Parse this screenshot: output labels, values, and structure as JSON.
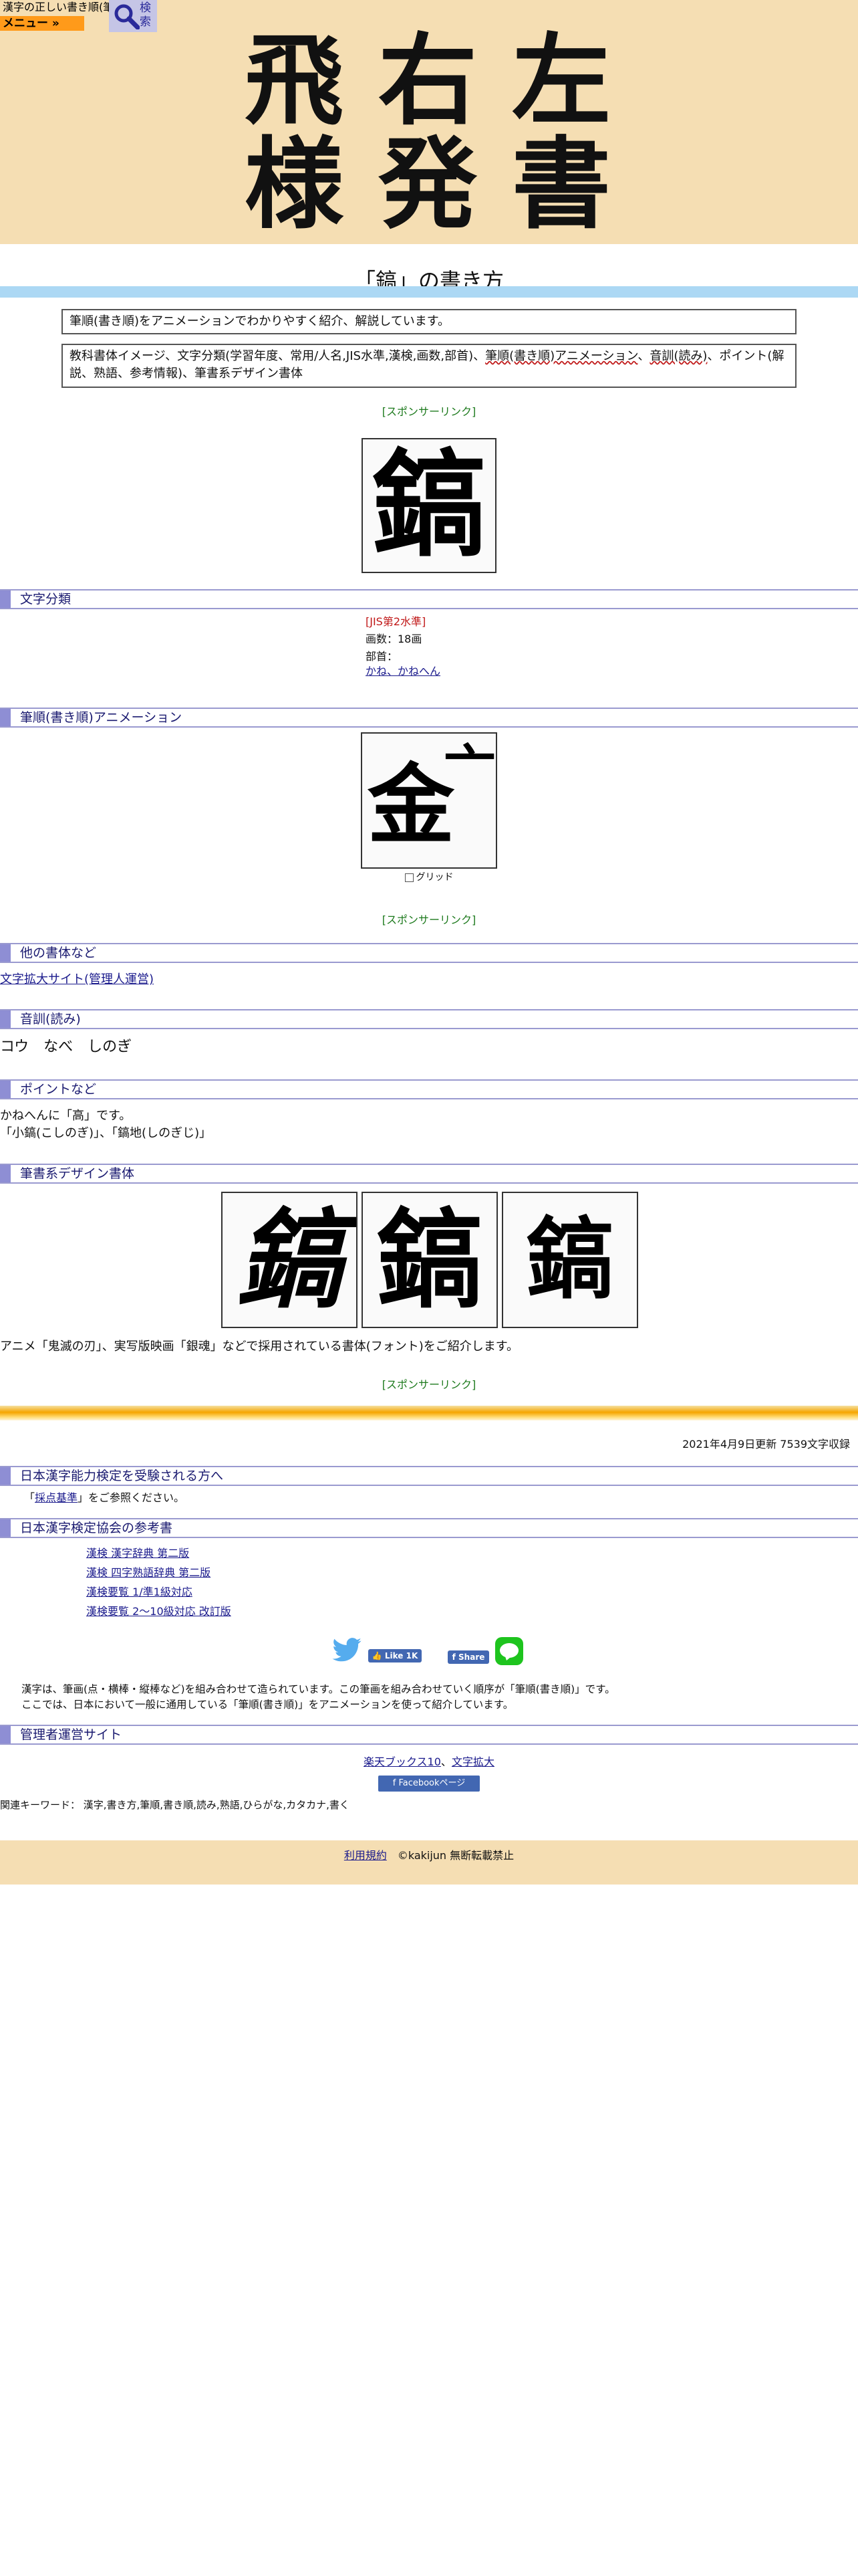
{
  "header": {
    "logo_title": "漢字の正しい書き順(筆順)",
    "menu_label": "メニュー »",
    "search_label": "検索",
    "hero_chars": [
      "飛",
      "右",
      "左",
      "様",
      "発",
      "書"
    ]
  },
  "page_title": "「鎬」の書き方",
  "intro_box1": "筆順(書き順)をアニメーションでわかりやすく紹介、解説しています。",
  "intro_box2_parts": {
    "before": "教科書体イメージ、文字分類(学習年度、常用/人名,JIS水準,漢検,画数,部首)、",
    "link1": "筆順(書き順)アニメーション",
    "mid": "、",
    "link2": "音訓(読み)",
    "after": "、ポイント(解説、熟語、参考情報)、筆書系デザイン書体"
  },
  "sponsor_label": "[スポンサーリンク]",
  "main_kanji": "鎬",
  "sections": {
    "classification": "文字分類",
    "animation": "筆順(書き順)アニメーション",
    "other_fonts": "他の書体など",
    "reading": "音訓(読み)",
    "points": "ポイントなど",
    "design": "筆書系デザイン書体",
    "kentei_exam": "日本漢字能力検定を受験される方へ",
    "kentei_books": "日本漢字検定協会の参考書",
    "admin_sites": "管理者運営サイト"
  },
  "classification": {
    "jis": "[JIS第2水準]",
    "strokes": "画数：18画",
    "radical_label": "部首：",
    "radical_link": "かね、かねへん"
  },
  "animation": {
    "partial_char": "金",
    "partial_stroke": "亠",
    "grid_label": "グリッド"
  },
  "other_fonts_link": "文字拡大サイト(管理人運営)",
  "reading": "コウ　なべ　しのぎ",
  "points": {
    "line1": "かねへんに「高」です。",
    "line2": "「小鎬(こしのぎ)」、「鎬地(しのぎじ)」"
  },
  "design": {
    "chars": [
      "鎬",
      "鎬",
      "鎬"
    ],
    "caption": "アニメ「鬼滅の刃」、実写版映画「銀魂」などで採用されている書体(フォント)をご紹介します。"
  },
  "updated": "2021年4月9日更新 7539文字収録",
  "kentei": {
    "pre": "「",
    "link": "採点基準",
    "post": "」をご参照ください。"
  },
  "books": [
    "漢検 漢字辞典 第二版",
    "漢検 四字熟語辞典 第二版",
    "漢検要覧 1/準1級対応",
    "漢検要覧 2～10級対応 改訂版"
  ],
  "social": {
    "like_label": "Like 1K",
    "share_label": "Share",
    "line_label": "LINE"
  },
  "explain": {
    "line1": "漢字は、筆画(点・横棒・縦棒など)を組み合わせて造られています。この筆画を組み合わせていく順序が「筆順(書き順)」です。",
    "line2": "ここでは、日本において一般に通用している「筆順(書き順)」をアニメーションを使って紹介しています。"
  },
  "admin_links": {
    "link1": "楽天ブックス10",
    "sep": "、",
    "link2": "文字拡大"
  },
  "facebook_page": "Facebookページ",
  "keywords": "関連キーワード： 漢字,書き方,筆順,書き順,読み,熟語,ひらがな,カタカナ,書く",
  "footer": {
    "terms": "利用規約",
    "copyright": "©kakijun 無断転載禁止"
  },
  "colors": {
    "header_bg": "#f5deb3",
    "menu_orange": "#ff9a1a",
    "title_blue_bar": "#acd8f4",
    "section_accent": "#8e8ed4",
    "sponsor_green": "#1d7a1d",
    "jis_red": "#c01818",
    "link_blue": "#1a1a8c",
    "twitter_blue": "#55acee",
    "line_green": "#1ec41e"
  }
}
